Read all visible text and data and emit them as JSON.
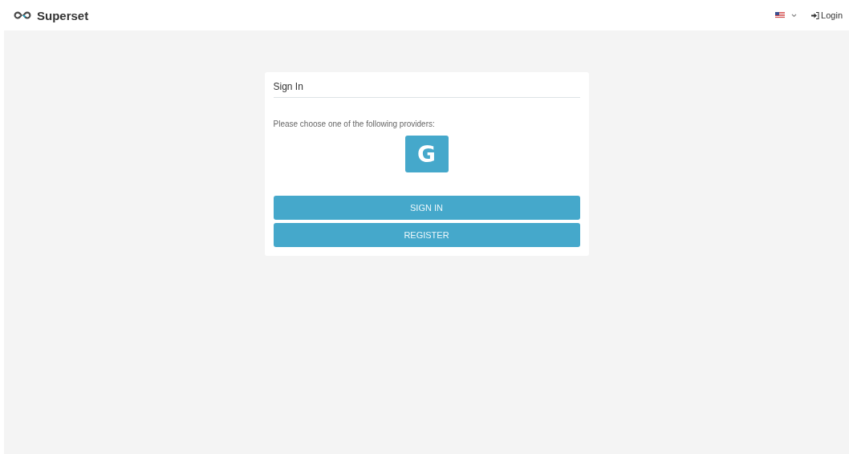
{
  "navbar": {
    "brand": "Superset",
    "login": "Login"
  },
  "signin": {
    "title": "Sign In",
    "prompt": "Please choose one of the following providers:",
    "providers": [
      {
        "label": "G",
        "selected": false
      }
    ],
    "buttons": [
      "SIGN IN",
      "REGISTER"
    ]
  }
}
